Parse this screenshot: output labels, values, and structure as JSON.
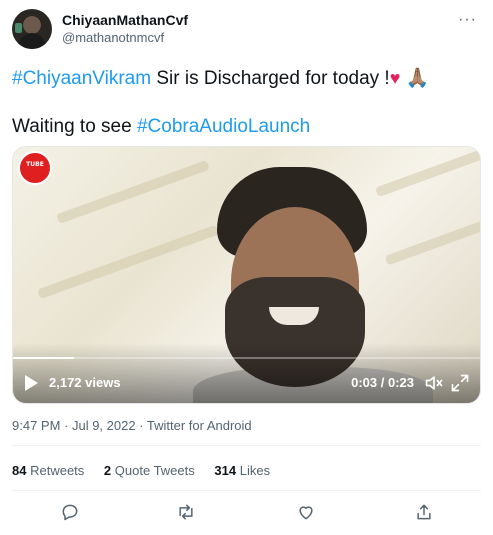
{
  "user": {
    "display_name": "ChiyaanMathanCvf",
    "handle": "@mathanotnmcvf"
  },
  "more_icon": "more-horizontal-icon",
  "tweet": {
    "line1": {
      "hashtag": "#ChiyaanVikram",
      "text": " Sir is Discharged for today !",
      "emoji_heart": "♥",
      "emoji_pray": "🙏🏽"
    },
    "line2": {
      "text": "Waiting to see ",
      "hashtag": "#CobraAudioLaunch"
    }
  },
  "video": {
    "channel_logo_text": "TUBE",
    "views": "2,172 views",
    "time": "0:03 / 0:23",
    "progress": 0.13,
    "icons": [
      "play-icon",
      "mute-icon",
      "expand-icon"
    ]
  },
  "meta": "9:47 PM · Jul 9, 2022 · Twitter for Android",
  "stats": {
    "retweets_count": "84",
    "retweets_label": "Retweets",
    "quotes_count": "2",
    "quotes_label": "Quote Tweets",
    "likes_count": "314",
    "likes_label": "Likes"
  },
  "actions": [
    "reply-icon",
    "retweet-icon",
    "like-icon",
    "share-icon"
  ],
  "colors": {
    "accent": "#1d9bf0",
    "heart": "#e0245e",
    "text": "#0f1419",
    "secondary": "#536471"
  }
}
